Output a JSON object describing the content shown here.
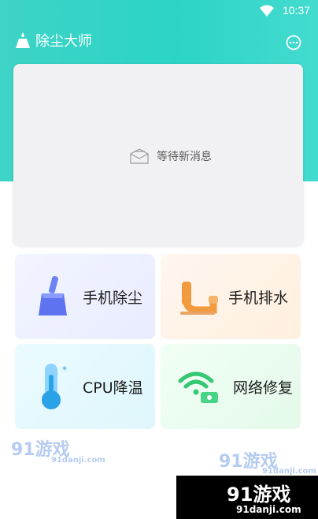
{
  "status_bar": {
    "time": "10:37"
  },
  "header": {
    "title": "除尘大师"
  },
  "message_panel": {
    "placeholder": "等待新消息"
  },
  "tiles": [
    {
      "label": "手机除尘",
      "icon": "broom-icon"
    },
    {
      "label": "手机排水",
      "icon": "pipe-icon"
    },
    {
      "label": "CPU降温",
      "icon": "thermometer-icon"
    },
    {
      "label": "网络修复",
      "icon": "wifi-repair-icon"
    }
  ],
  "watermark": {
    "brand": "91游戏",
    "url": "91danji.com",
    "banner_brand": "91游戏",
    "banner_url": "91danji.com"
  },
  "colors": {
    "header_teal": "#2bd5c5",
    "broom": "#5e73f0",
    "pipe": "#f19a3e",
    "thermo": "#2aa2e8",
    "wifi": "#35c873"
  }
}
